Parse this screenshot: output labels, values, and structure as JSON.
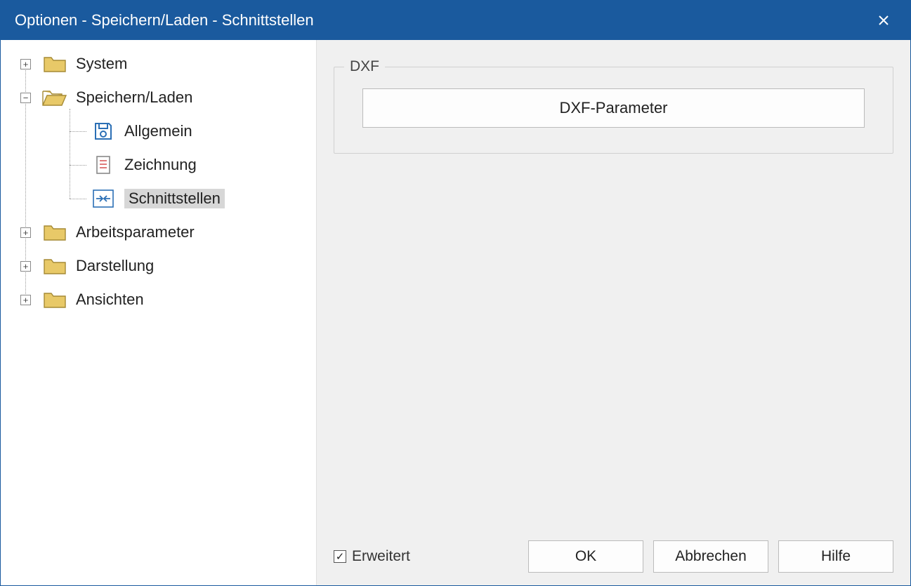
{
  "title": "Optionen - Speichern/Laden - Schnittstellen",
  "tree": {
    "items": [
      {
        "label": "System",
        "expander": "+"
      },
      {
        "label": "Speichern/Laden",
        "expander": "−",
        "children": [
          {
            "label": "Allgemein",
            "icon": "disk"
          },
          {
            "label": "Zeichnung",
            "icon": "doc"
          },
          {
            "label": "Schnittstellen",
            "icon": "interface",
            "selected": true
          }
        ]
      },
      {
        "label": "Arbeitsparameter",
        "expander": "+"
      },
      {
        "label": "Darstellung",
        "expander": "+"
      },
      {
        "label": "Ansichten",
        "expander": "+"
      }
    ]
  },
  "groupbox": {
    "title": "DXF",
    "button_label": "DXF-Parameter"
  },
  "footer": {
    "checkbox_label": "Erweitert",
    "checkbox_checked": true,
    "ok": "OK",
    "cancel": "Abbrechen",
    "help": "Hilfe"
  }
}
